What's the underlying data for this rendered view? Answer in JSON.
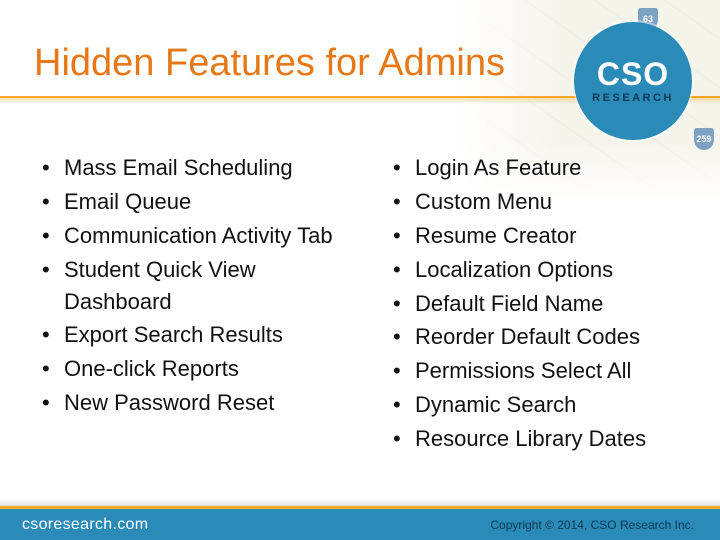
{
  "title": "Hidden Features for Admins",
  "logo": {
    "main": "CSO",
    "sub": "RESEARCH"
  },
  "map_shields": {
    "a": "63",
    "b": "259"
  },
  "left_features": [
    "Mass Email Scheduling",
    "Email Queue",
    "Communication Activity Tab",
    "Student Quick View Dashboard",
    "Export Search Results",
    "One-click Reports",
    "New Password Reset"
  ],
  "right_features": [
    "Login As Feature",
    "Custom Menu",
    "Resume Creator",
    "Localization Options",
    "Default Field Name",
    "Reorder Default Codes",
    "Permissions Select All",
    "Dynamic Search",
    "Resource Library Dates"
  ],
  "footer": {
    "site": "csoresearch.com",
    "copyright": "Copyright © 2014, CSO Research Inc."
  }
}
